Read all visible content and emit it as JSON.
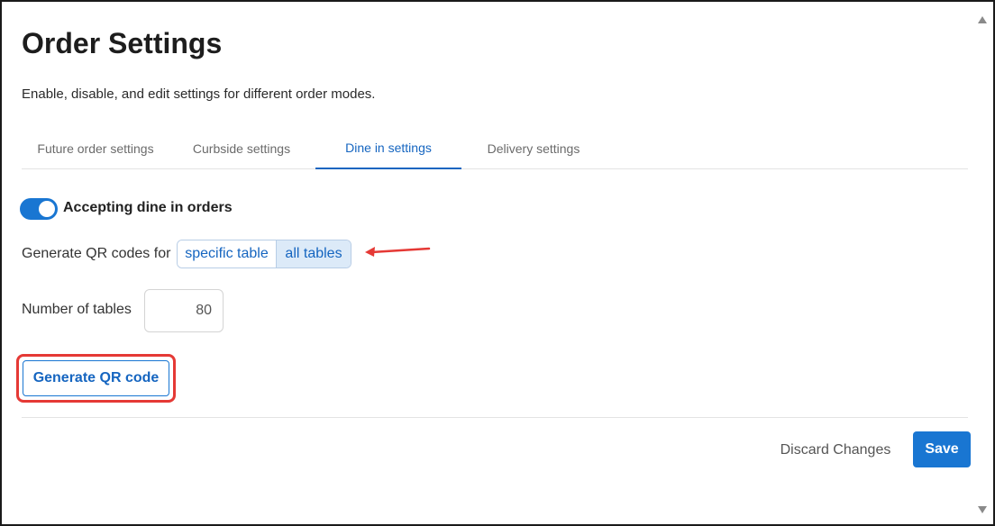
{
  "page": {
    "title": "Order Settings",
    "subtitle": "Enable, disable, and edit settings for different order modes."
  },
  "tabs": [
    {
      "label": "Future order settings",
      "active": false
    },
    {
      "label": "Curbside settings",
      "active": false
    },
    {
      "label": "Dine in settings",
      "active": true
    },
    {
      "label": "Delivery settings",
      "active": false
    }
  ],
  "dine_in": {
    "toggle_on": true,
    "toggle_label": "Accepting dine in orders",
    "qr_label": "Generate QR codes for",
    "qr_options": [
      "specific table",
      "all tables"
    ],
    "qr_selected": "all tables",
    "tables_label": "Number of tables",
    "tables_value": "80",
    "generate_button": "Generate QR code"
  },
  "footer": {
    "discard_label": "Discard Changes",
    "save_label": "Save"
  },
  "annotations": {
    "highlight_color": "#e53935"
  },
  "colors": {
    "accent": "#1976d2",
    "selected_bg": "#dceaf8"
  },
  "icons": [
    "scroll-up-icon",
    "scroll-down-icon",
    "annotation-arrow-icon"
  ]
}
